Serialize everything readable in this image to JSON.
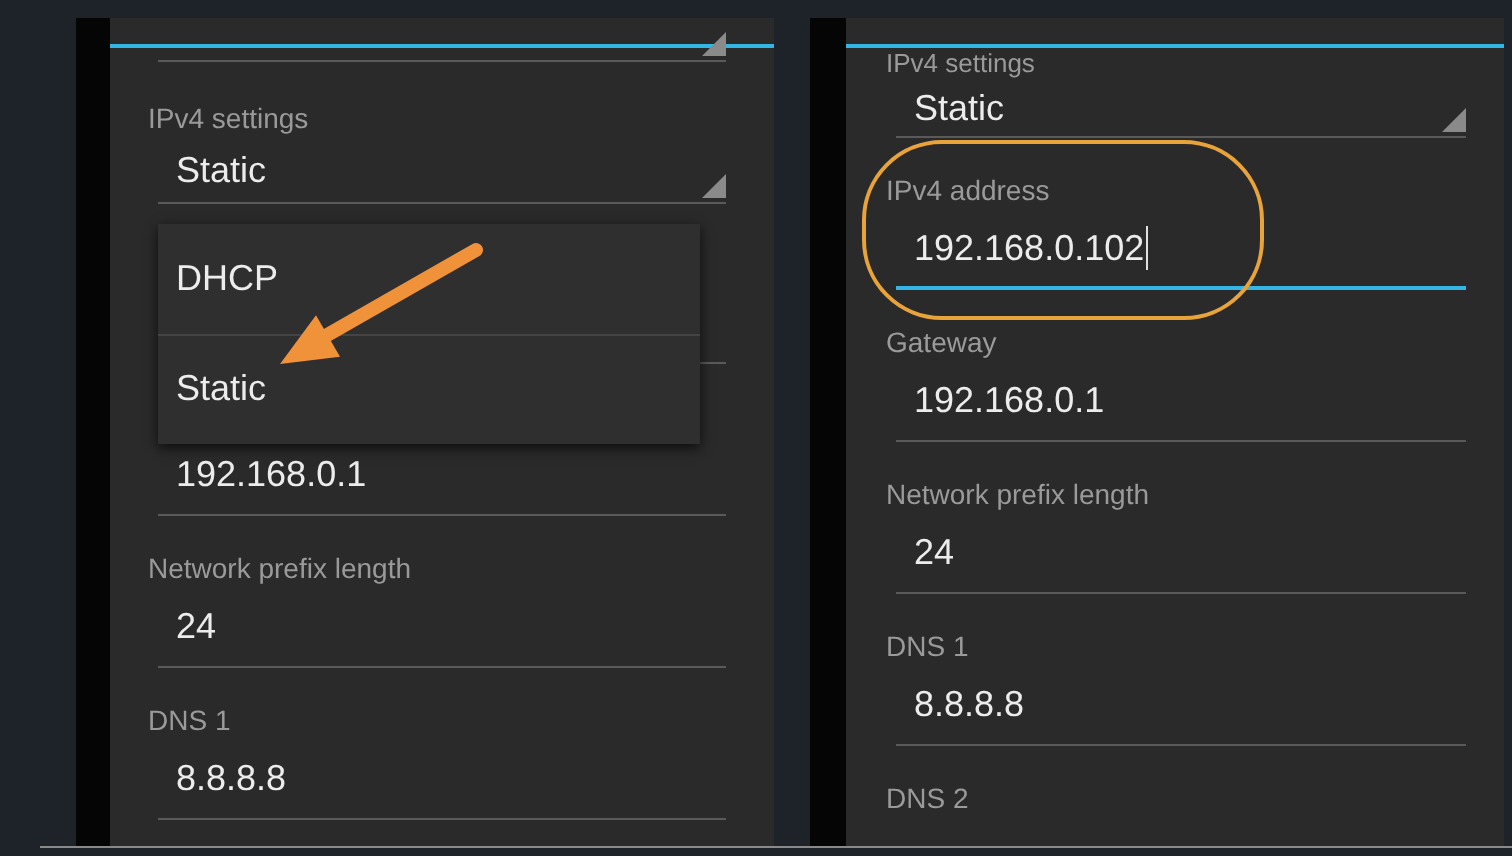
{
  "left_screen": {
    "ipv4_settings": {
      "label": "IPv4 settings",
      "value": "Static"
    },
    "dropdown_menu": {
      "options": [
        "DHCP",
        "Static"
      ]
    },
    "fields": [
      {
        "value": "192.168.0.1"
      },
      {
        "label": "Network prefix length",
        "value": "24"
      },
      {
        "label": "DNS 1",
        "value": "8.8.8.8"
      }
    ]
  },
  "right_screen": {
    "ipv4_settings": {
      "label": "IPv4 settings",
      "value": "Static"
    },
    "fields": [
      {
        "label": "IPv4 address",
        "value": "192.168.0.102",
        "focused": true,
        "highlighted": true
      },
      {
        "label": "Gateway",
        "value": "192.168.0.1",
        "focused": false,
        "highlighted": false
      },
      {
        "label": "Network prefix length",
        "value": "24",
        "focused": false,
        "highlighted": false
      },
      {
        "label": "DNS 1",
        "value": "8.8.8.8",
        "focused": false,
        "highlighted": false
      },
      {
        "label": "DNS 2"
      }
    ]
  }
}
